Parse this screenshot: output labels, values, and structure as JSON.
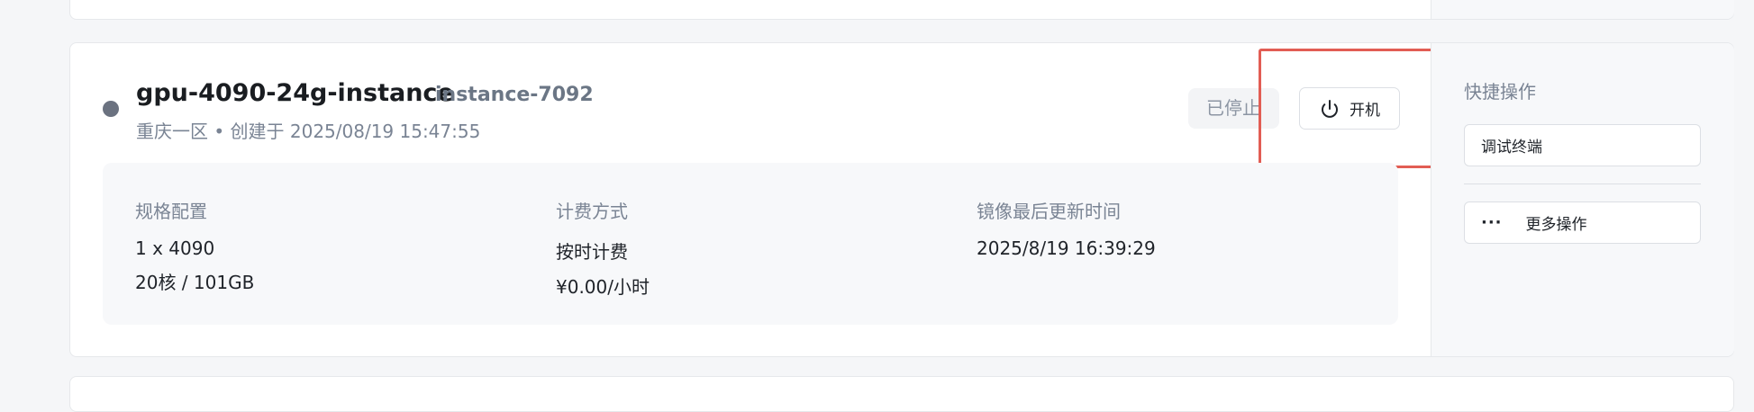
{
  "instance": {
    "name": "gpu-4090-24g-instance",
    "id": "instance-7092",
    "subtitle": "重庆一区 • 创建于 2025/08/19 15:47:55",
    "status": "已停止",
    "status_color": "#6b7280"
  },
  "actions": {
    "power_on_label": "开机",
    "highlight_color": "#e25d54"
  },
  "specs": {
    "config": {
      "label": "规格配置",
      "line1": "1 x 4090",
      "line2": "20核 / 101GB"
    },
    "billing": {
      "label": "计费方式",
      "line1": "按时计费",
      "line2": "¥0.00/小时"
    },
    "image": {
      "label": "镜像最后更新时间",
      "line1": "2025/8/19 16:39:29"
    }
  },
  "quick_actions": {
    "title": "快捷操作",
    "debug_terminal": "调试终端",
    "more_icon": "ellipsis-icon",
    "more": "更多操作"
  }
}
